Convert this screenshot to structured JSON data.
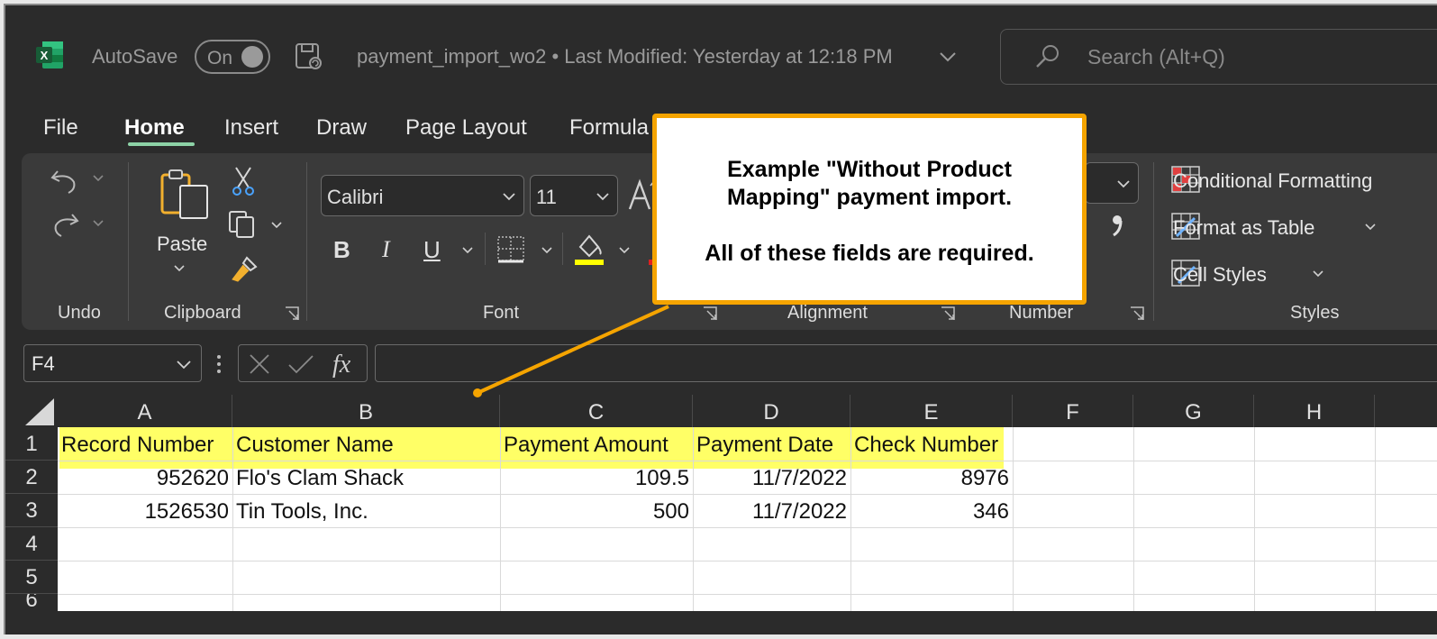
{
  "titlebar": {
    "autosave_label": "AutoSave",
    "autosave_state": "On",
    "file_title": "payment_import_wo2  •  Last Modified: Yesterday at 12:18 PM",
    "search_placeholder": "Search (Alt+Q)"
  },
  "tabs": [
    "File",
    "Home",
    "Insert",
    "Draw",
    "Page Layout",
    "Formula"
  ],
  "ribbon": {
    "groups": {
      "undo": "Undo",
      "clipboard": "Clipboard",
      "font": "Font",
      "alignment": "Alignment",
      "number": "Number",
      "styles": "Styles"
    },
    "paste_label": "Paste",
    "font_name": "Calibri",
    "font_size": "11",
    "bold": "B",
    "italic": "I",
    "underline": "U",
    "styles_items": [
      "Conditional Formatting",
      "Format as Table",
      "Cell Styles"
    ]
  },
  "formula_bar": {
    "name_box": "F4",
    "formula": ""
  },
  "sheet": {
    "columns": [
      "A",
      "B",
      "C",
      "D",
      "E",
      "F",
      "G",
      "H"
    ],
    "rows": [
      "1",
      "2",
      "3",
      "4",
      "5",
      "6"
    ],
    "headers": [
      "Record Number",
      "Customer Name",
      "Payment Amount",
      "Payment Date",
      "Check Number"
    ],
    "data": [
      [
        "952620",
        "Flo's Clam Shack",
        "109.5",
        "11/7/2022",
        "8976"
      ],
      [
        "1526530",
        "Tin Tools, Inc.",
        "500",
        "11/7/2022",
        "346"
      ]
    ]
  },
  "callout": {
    "title": "Example \"Without Product Mapping\" payment import.",
    "note": "All of these fields are required."
  },
  "colors": {
    "app_bg": "#2b2b2b",
    "ribbon_bg": "#3a3a3a",
    "header_highlight": "#ffff66",
    "callout_border": "#f5a400",
    "active_tab_underline": "#8dd3a7"
  }
}
